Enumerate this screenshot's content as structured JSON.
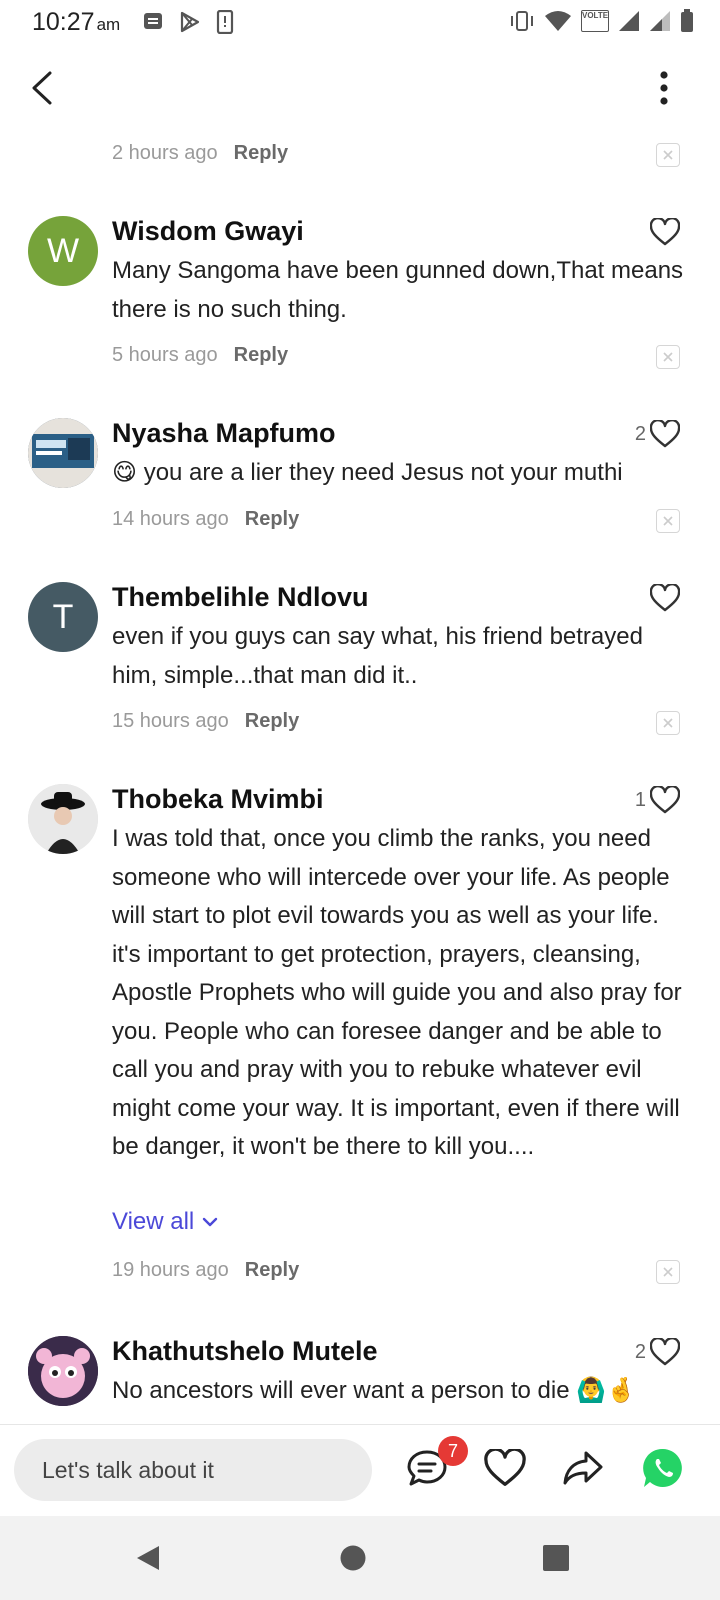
{
  "status_bar": {
    "time": "10:27",
    "ampm": "am",
    "icons_left": [
      "notification-icon",
      "play-store-icon",
      "device-icon"
    ],
    "icons_right": [
      "vibrate-icon",
      "wifi-icon",
      "volte-icon",
      "signal-icon",
      "signal-2-icon",
      "battery-icon"
    ],
    "volte_label": "VOLTE"
  },
  "top_bar": {
    "back_icon": "back-chevron-icon",
    "more_icon": "more-vertical-icon"
  },
  "first_meta": {
    "time": "2 hours ago",
    "reply": "Reply"
  },
  "comments": [
    {
      "name": "Wisdom Gwayi",
      "avatar_letter": "W",
      "avatar_color": "#76a33a",
      "likes": "",
      "text": "Many Sangoma have been gunned down,That means there is no such thing.",
      "time": "5 hours ago",
      "reply": "Reply"
    },
    {
      "name": "Nyasha Mapfumo",
      "avatar_letter": "",
      "avatar_color": "#4a6a8a",
      "likes": "2",
      "text": "😋 you are a lier they need Jesus not your muthi",
      "time": "14 hours ago",
      "reply": "Reply"
    },
    {
      "name": "Thembelihle Ndlovu",
      "avatar_letter": "T",
      "avatar_color": "#455a64",
      "likes": "",
      "text": "even if you guys can say what, his friend betrayed him, simple...that man did it..",
      "time": "15 hours ago",
      "reply": "Reply"
    },
    {
      "name": "Thobeka Mvimbi",
      "avatar_letter": "",
      "avatar_color": "#dcdcdc",
      "likes": "1",
      "text": "I was told that, once you climb the ranks, you need someone who will intercede over your life. As people will start to plot evil towards you as well as your life. it's important to get protection, prayers, cleansing, Apostle Prophets who will guide you and also pray for you. People who can foresee danger and be able to call you and pray with you to rebuke whatever evil might come your way. It is important, even if there will be danger, it won't be there to kill you....",
      "view_all": "View all",
      "time": "19 hours ago",
      "reply": "Reply"
    },
    {
      "name": "Khathutshelo Mutele",
      "avatar_letter": "",
      "avatar_color": "#3a2b4a",
      "likes": "2",
      "text": "No ancestors will ever want a person to die 🙆‍♂️🤞",
      "time": "",
      "reply": ""
    }
  ],
  "bottom_bar": {
    "placeholder": "Let's talk about it",
    "comment_count": "7",
    "icons": [
      "comments-icon",
      "heart-icon",
      "share-icon",
      "whatsapp-icon"
    ]
  },
  "colors": {
    "accent_link": "#4b48d8",
    "badge": "#e53935",
    "whatsapp": "#25d366"
  }
}
